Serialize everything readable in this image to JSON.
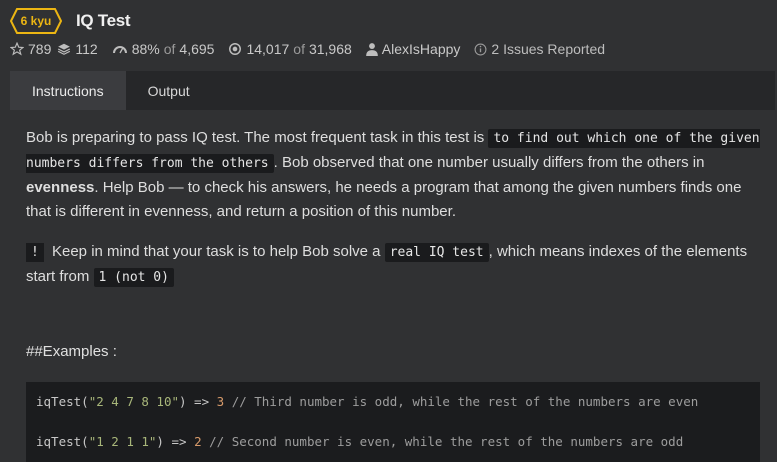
{
  "header": {
    "kyu_label": "6 kyu",
    "title": "IQ Test"
  },
  "stats": {
    "stars": "789",
    "collections": "112",
    "satisfaction": "88%",
    "satisfaction_of": "of",
    "satisfaction_votes": "4,695",
    "completed": "14,017",
    "completed_of": "of",
    "attempted": "31,968",
    "author": "AlexIsHappy",
    "issues": "2 Issues Reported"
  },
  "tabs": [
    {
      "label": "Instructions",
      "active": true
    },
    {
      "label": "Output",
      "active": false
    }
  ],
  "description": {
    "p1_a": "Bob is preparing to pass IQ test. The most frequent task in this test is ",
    "p1_code": "to find out which one of the given numbers differs from the others",
    "p1_b": ". Bob observed that one number usually differs from the others in ",
    "p1_bold": "evenness",
    "p1_c": ". Help Bob — to check his answers, he needs a program that among the given numbers finds one that is different in evenness, and return a position of this number.",
    "bang": "!",
    "p2_a": " Keep in mind that your task is to help Bob solve a ",
    "p2_code": "real IQ test",
    "p2_b": ", which means indexes of the elements start from ",
    "p2_code2": "1 (not 0)",
    "examples": "##Examples :"
  },
  "code": {
    "line1_fn": "iqTest(",
    "line1_str": "\"2 4 7 8 10\"",
    "line1_mid": ") => ",
    "line1_num": "3",
    "line1_comment": " // Third number is odd, while the rest of the numbers are even",
    "line2_fn": "iqTest(",
    "line2_str": "\"1 2 1 1\"",
    "line2_mid": ") => ",
    "line2_num": "2",
    "line2_comment": " // Second number is even, while the rest of the numbers are odd"
  },
  "colors": {
    "kyu_accent": "#ecb613",
    "background": "#303133",
    "panel": "#262729"
  }
}
